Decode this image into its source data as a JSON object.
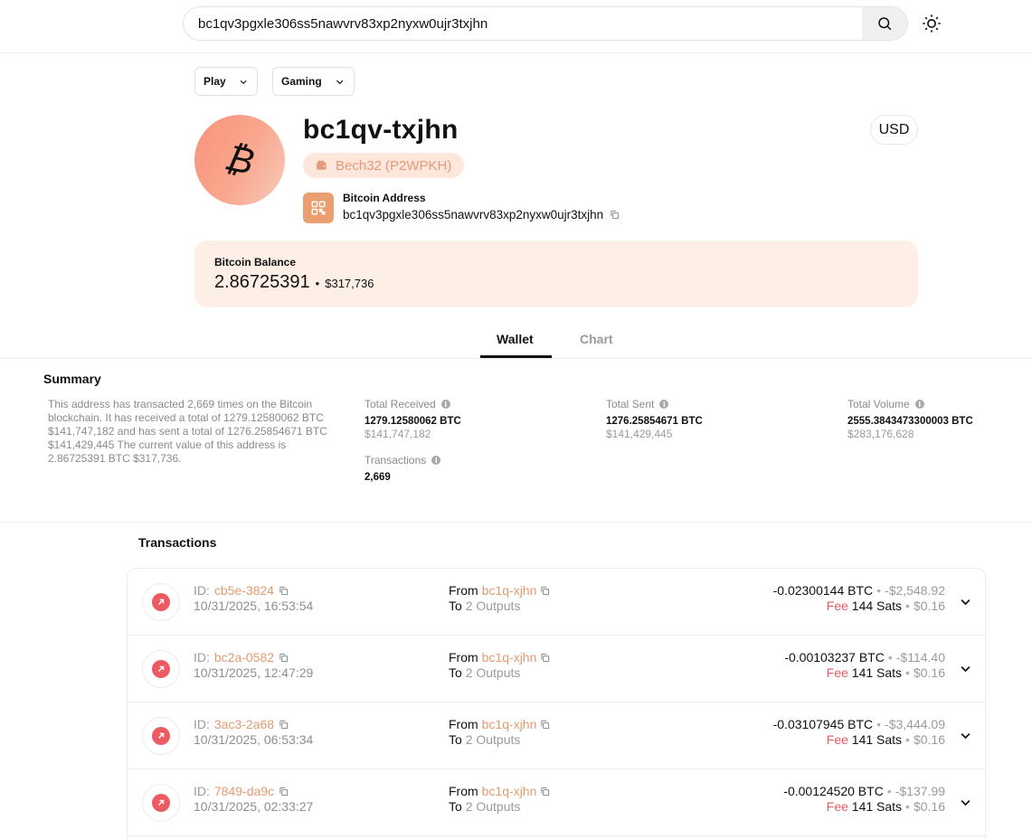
{
  "search": {
    "value": "bc1qv3pgxle306ss5nawvrv83xp2nyxw0ujr3txjhn"
  },
  "filters": {
    "play_label": "Play",
    "gaming_label": "Gaming"
  },
  "profile": {
    "avatar_glyph": "₿",
    "short_address": "bc1qv-txjhn",
    "address_type": "Bech32 (P2WPKH)",
    "address_label": "Bitcoin Address",
    "address_value": "bc1qv3pgxle306ss5nawvrv83xp2nyxw0ujr3txjhn",
    "currency": "USD"
  },
  "balance": {
    "label": "Bitcoin Balance",
    "btc": "2.86725391",
    "separator": "•",
    "usd": "$317,736"
  },
  "tabs": {
    "wallet": "Wallet",
    "chart": "Chart",
    "active": "Wallet"
  },
  "summary": {
    "title": "Summary",
    "text": "This address has transacted 2,669 times on the Bitcoin blockchain. It has received a total of 1279.12580062 BTC $141,747,182 and has sent a total of 1276.25854671 BTC $141,429,445 The current value of this address is 2.86725391 BTC $317,736.",
    "total_received": {
      "label": "Total Received",
      "btc": "1279.12580062 BTC",
      "usd": "$141,747,182"
    },
    "total_sent": {
      "label": "Total Sent",
      "btc": "1276.25854671 BTC",
      "usd": "$141,429,445"
    },
    "total_volume": {
      "label": "Total Volume",
      "btc": "2555.3843473300003 BTC",
      "usd": "$283,176,628"
    },
    "transactions": {
      "label": "Transactions",
      "value": "2,669"
    }
  },
  "transactions": {
    "title": "Transactions",
    "id_prefix": "ID:",
    "from_label": "From",
    "to_label": "To",
    "fee_label": "Fee",
    "items": [
      {
        "id": "cb5e-3824",
        "date": "10/31/2025, 16:53:54",
        "from": "bc1q-xjhn",
        "to": "2 Outputs",
        "amount_btc": "-0.02300144 BTC",
        "amount_usd": "-$2,548.92",
        "fee_sats": "144 Sats",
        "fee_usd": "$0.16"
      },
      {
        "id": "bc2a-0582",
        "date": "10/31/2025, 12:47:29",
        "from": "bc1q-xjhn",
        "to": "2 Outputs",
        "amount_btc": "-0.00103237 BTC",
        "amount_usd": "-$114.40",
        "fee_sats": "141 Sats",
        "fee_usd": "$0.16"
      },
      {
        "id": "3ac3-2a68",
        "date": "10/31/2025, 06:53:34",
        "from": "bc1q-xjhn",
        "to": "2 Outputs",
        "amount_btc": "-0.03107945 BTC",
        "amount_usd": "-$3,444.09",
        "fee_sats": "141 Sats",
        "fee_usd": "$0.16"
      },
      {
        "id": "7849-da9c",
        "date": "10/31/2025, 02:33:27",
        "from": "bc1q-xjhn",
        "to": "2 Outputs",
        "amount_btc": "-0.00124520 BTC",
        "amount_usd": "-$137.99",
        "fee_sats": "141 Sats",
        "fee_usd": "$0.16"
      }
    ]
  },
  "icons": {
    "search": "search-icon",
    "theme": "sun-icon",
    "chevron": "chevron-down-icon",
    "wallet": "wallet-icon",
    "qr": "qr-code-icon",
    "copy": "copy-icon",
    "info": "info-icon",
    "outgoing": "arrow-up-right-icon"
  },
  "colors": {
    "accent_orange": "#e39a6f",
    "balance_bg": "#fdeee6",
    "badge_bg": "#fde6dc",
    "outgoing_red": "#ec5a62"
  }
}
